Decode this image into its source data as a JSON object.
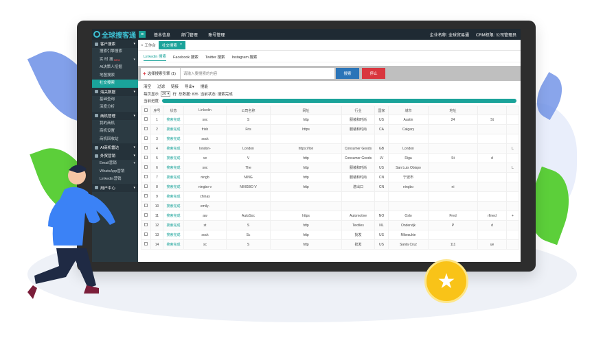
{
  "app": {
    "logo_text": "全球搜客通"
  },
  "topbar": {
    "nav": [
      "基本信息",
      "部门管理",
      "账号管理"
    ],
    "company_label": "企业名称: 全球贸易通",
    "role_label": "CRM权限: 公司管理员"
  },
  "sidebar": {
    "groups": [
      {
        "label": "客户搜索",
        "items": [
          {
            "label": "搜索引擎搜索"
          },
          {
            "label": "实 时 搜",
            "badge": "NEW",
            "caret": "▾"
          },
          {
            "label": "AI决策人挖掘"
          },
          {
            "label": "地图搜索"
          },
          {
            "label": "社交搜索",
            "active": true
          }
        ]
      },
      {
        "label": "海关数据",
        "items": [
          {
            "label": "基础查询"
          },
          {
            "label": "深度分析"
          }
        ]
      },
      {
        "label": "商机管理",
        "items": [
          {
            "label": "我的商机"
          },
          {
            "label": "商机设置"
          },
          {
            "label": "商机回收站"
          }
        ]
      },
      {
        "label": "AI商机雷达",
        "items": []
      },
      {
        "label": "外贸营销",
        "items": [
          {
            "label": "Email营销",
            "caret": "▾"
          },
          {
            "label": "WhatsApp营销"
          },
          {
            "label": "Linkedin营销"
          }
        ]
      },
      {
        "label": "用户中心",
        "items": []
      }
    ]
  },
  "tabs": {
    "home": "工作台",
    "active": "社交搜索"
  },
  "subtabs": [
    "Linkedin 搜索",
    "Facebook 搜索",
    "Twitter 搜索",
    "Instagram 搜索"
  ],
  "search": {
    "engine_label": "选择搜索引擎 (1)",
    "keyword_placeholder": "请输入要搜索的内容",
    "search_button": "搜索",
    "stop_button": "停止"
  },
  "toolbar": [
    "清空",
    "过滤",
    "链接",
    "导出▾",
    "搜能"
  ],
  "pager": {
    "per_page_label": "每页显示",
    "per_page_value": "20",
    "unit": "行",
    "total_label": "总数据: 835",
    "status_label": "当前状态: 搜索完成",
    "progress_label": "当前进度:",
    "progress": 1.0
  },
  "table": {
    "columns": [
      "",
      "序号",
      "状态",
      "Linkedin",
      "公司名称",
      "网址",
      "行业",
      "国家",
      "城市",
      "地址",
      "",
      ""
    ],
    "rows": [
      [
        "",
        "1",
        "搜索完成",
        "soc",
        "S",
        "http",
        "服装和时尚",
        "US",
        "Austin",
        "24",
        "St",
        ""
      ],
      [
        "",
        "2",
        "搜索完成",
        "frisb",
        "Fris",
        "https",
        "服装和时尚",
        "CA",
        "Calgary",
        "",
        "",
        ""
      ],
      [
        "",
        "3",
        "搜索完成",
        "sock",
        "",
        "",
        "",
        "",
        "",
        "",
        "",
        ""
      ],
      [
        "",
        "4",
        "搜索完成",
        "london-",
        "London",
        "https://lon",
        "Consumer Goods",
        "GB",
        "London",
        "",
        "",
        "L"
      ],
      [
        "",
        "5",
        "搜索完成",
        "ve",
        "V",
        "http",
        "Consumer Goods",
        "LV",
        "Riga",
        "St",
        "d",
        ""
      ],
      [
        "",
        "6",
        "搜索完成",
        "soc",
        "The",
        "http",
        "服装和时尚",
        "US",
        "San Luis Obispo",
        "",
        "",
        "L"
      ],
      [
        "",
        "7",
        "搜索完成",
        "ningb",
        "NING",
        "http",
        "服装和时尚",
        "CN",
        "宁波市",
        "",
        "",
        ""
      ],
      [
        "",
        "8",
        "搜索完成",
        "ningbo-v",
        "NINGBO V",
        "http",
        "进出口",
        "CN",
        "ningbo",
        "ni",
        "",
        ""
      ],
      [
        "",
        "9",
        "搜索完成",
        "chinas",
        "",
        "",
        "",
        "",
        "",
        "",
        "",
        ""
      ],
      [
        "",
        "10",
        "搜索完成",
        "emily-",
        "",
        "",
        "",
        "",
        "",
        "",
        "",
        ""
      ],
      [
        "",
        "11",
        "搜索完成",
        "aw",
        "AutoSoc",
        "https",
        "Automotive",
        "NO",
        "Oslo",
        "Fred",
        "rfined",
        "+"
      ],
      [
        "",
        "12",
        "搜索完成",
        "st",
        "S",
        "http",
        "Textiles",
        "NL",
        "Ondervijk",
        "P",
        "d",
        ""
      ],
      [
        "",
        "13",
        "搜索完成",
        "sock",
        "Sc",
        "http",
        "批发",
        "US",
        "Milwaukie",
        "",
        "",
        ""
      ],
      [
        "",
        "14",
        "搜索完成",
        "sc",
        "S",
        "http",
        "批发",
        "US",
        "Santa Cruz",
        "111",
        "ue",
        ""
      ]
    ]
  },
  "colors": {
    "accent": "#1aa39a",
    "danger": "#d9363e",
    "primary": "#2a74b8",
    "badge": "#f9c318"
  }
}
